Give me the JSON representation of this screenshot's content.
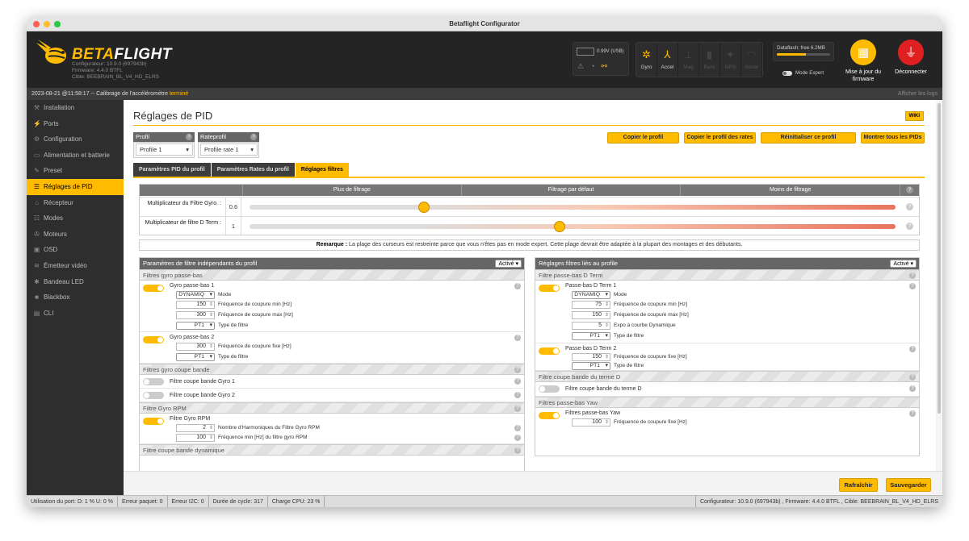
{
  "window": {
    "title": "Betaflight Configurator"
  },
  "header": {
    "brand_a": "BETA",
    "brand_b": "FLIGHT",
    "configurator": "Configurateur: 10.9.0 (697943b)",
    "firmware": "Firmware: 4.4.0 BTFL",
    "target": "Cible: BEEBRAIN_BL_V4_HD_ELRS",
    "battery": "0.99V (USB)",
    "sensors": [
      {
        "label": "Gyro",
        "icon": "gyro-icon",
        "active": true
      },
      {
        "label": "Accel",
        "icon": "accel-icon",
        "active": true
      },
      {
        "label": "Mag",
        "icon": "mag-icon",
        "active": false
      },
      {
        "label": "Baro",
        "icon": "baro-icon",
        "active": false
      },
      {
        "label": "GPS",
        "icon": "gps-icon",
        "active": false
      },
      {
        "label": "Sonar",
        "icon": "sonar-icon",
        "active": false
      }
    ],
    "dataflash": "Dataflash: free 6.2MB",
    "dataflash_fill": 0.55,
    "expert_mode": "Mode Expert",
    "update_label_1": "Mise à jour du",
    "update_label_2": "firmware",
    "disconnect_label": "Déconnecter"
  },
  "logbar": {
    "text": "2023-08-21 @11:58:17 -- Calibrage de l'accéléromètre",
    "status": "terminé",
    "show_logs": "Afficher les logs"
  },
  "sidebar": {
    "items": [
      {
        "label": "Installation",
        "icon": "wrench-icon",
        "active": false
      },
      {
        "label": "Ports",
        "icon": "plug-icon",
        "active": false
      },
      {
        "label": "Configuration",
        "icon": "gear-icon",
        "active": false
      },
      {
        "label": "Alimentation et batterie",
        "icon": "battery-icon",
        "active": false
      },
      {
        "label": "Preset",
        "icon": "preset-icon",
        "active": false
      },
      {
        "label": "Réglages de PID",
        "icon": "sliders-icon",
        "active": true
      },
      {
        "label": "Récepteur",
        "icon": "receiver-icon",
        "active": false
      },
      {
        "label": "Modes",
        "icon": "modes-icon",
        "active": false
      },
      {
        "label": "Moteurs",
        "icon": "motor-icon",
        "active": false
      },
      {
        "label": "OSD",
        "icon": "osd-icon",
        "active": false
      },
      {
        "label": "Émetteur vidéo",
        "icon": "vtx-icon",
        "active": false
      },
      {
        "label": "Bandeau LED",
        "icon": "led-icon",
        "active": false
      },
      {
        "label": "Blackbox",
        "icon": "blackbox-icon",
        "active": false
      },
      {
        "label": "CLI",
        "icon": "cli-icon",
        "active": false
      }
    ]
  },
  "main": {
    "title": "Réglages de PID",
    "wiki": "WIKI",
    "profile_label": "Profil",
    "profile_value": "Profile 1",
    "rateprofile_label": "Rateprofil",
    "rateprofile_value": "Profile rate 1",
    "buttons": {
      "copy_profile": "Copier le profil",
      "copy_rates": "Copier le profil des rates",
      "reset_profile": "Réinitialiser ce profil",
      "show_pids": "Montrer tous les PIDs"
    },
    "tabs": [
      {
        "label": "Paramètres PID du profil",
        "active": false
      },
      {
        "label": "Paramètres Rates du profil",
        "active": false
      },
      {
        "label": "Réglages filtres",
        "active": true
      }
    ],
    "slider_header": [
      "Plus de filtrage",
      "Filtrage par défaut",
      "Moins de filtrage"
    ],
    "sliders": [
      {
        "label": "Multiplicateur du Filtre Gyro. :",
        "value": "0.6",
        "fraction": 0.27
      },
      {
        "label": "Multiplicateur de filtre D Term :",
        "value": "1",
        "fraction": 0.48
      }
    ],
    "note_bold": "Remarque :",
    "note": "La plage des curseurs est restreinte parce que vous n'êtes pas en mode expert. Cette plage devrait être adaptée à la plupart des montages et des débutants.",
    "left_panel": {
      "title": "Paramètres de filtre indépendants du profil",
      "state": "Activé",
      "sec_gyro_lp": "Filtres gyro passe-bas",
      "gyro_lp1": "Gyro passe-bas 1",
      "gyro_lp1_mode": "DYNAMIQ",
      "gyro_lp1_mode_label": "Mode",
      "gyro_lp1_min": "150",
      "gyro_lp1_min_label": "Fréquence de coupure min [Hz]",
      "gyro_lp1_max": "300",
      "gyro_lp1_max_label": "Fréquence de coupure max [Hz]",
      "gyro_lp1_type": "PT1",
      "gyro_lp1_type_label": "Type de filtre",
      "gyro_lp2": "Gyro passe-bas 2",
      "gyro_lp2_freq": "300",
      "gyro_lp2_freq_label": "Fréquence de coupure fixe [Hz]",
      "gyro_lp2_type": "PT1",
      "gyro_lp2_type_label": "Type de filtre",
      "sec_notch": "Filtres gyro coupe bande",
      "notch1": "Filtre coupe bande Gyro 1",
      "notch2": "Filtre coupe bande Gyro 2",
      "sec_rpm": "Filtre Gyro RPM",
      "rpm_name": "Filtre Gyro RPM",
      "rpm_harm": "2",
      "rpm_harm_label": "Nombre d'Harmoniques du Filtre Gyro RPM",
      "rpm_min": "100",
      "rpm_min_label": "Fréquence min [Hz] du filtre gyro RPM",
      "sec_dyn": "Filtre coupe bande dynamique"
    },
    "right_panel": {
      "title": "Réglages filtres liés au profile",
      "state": "Activé",
      "sec_dterm_lp": "Filtre passe-bas D Term",
      "dlp1": "Passe-bas D Term 1",
      "dlp1_mode": "DYNAMIQ",
      "dlp1_mode_label": "Mode",
      "dlp1_min": "75",
      "dlp1_min_label": "Fréquence de coupure min [Hz]",
      "dlp1_max": "150",
      "dlp1_max_label": "Fréquence de coupure max [Hz]",
      "dlp1_expo": "5",
      "dlp1_expo_label": "Expo à courbe Dynamique",
      "dlp1_type": "PT1",
      "dlp1_type_label": "Type de filtre",
      "dlp2": "Passe-bas D Term 2",
      "dlp2_freq": "150",
      "dlp2_freq_label": "Fréquence de coupure fixe [Hz]",
      "dlp2_type": "PT1",
      "dlp2_type_label": "Type de filtre",
      "sec_dnotch": "Filtre coupe bande du terme D",
      "dnotch": "Filtre coupe bande du terme D",
      "sec_yaw": "Filtres passe-bas Yaw",
      "yaw": "Filtres passe-bas Yaw",
      "yaw_freq": "100",
      "yaw_freq_label": "Fréquence de coupure fixe [Hz]"
    },
    "refresh": "Rafraîchir",
    "save": "Sauvegarder"
  },
  "status": {
    "port": "Utilisation du port: D: 1 % U: 0 %",
    "packet": "Erreur paquet: 0",
    "i2c": "Erreur I2C: 0",
    "cycle": "Durée de cycle: 317",
    "cpu": "Charge CPU: 23 %",
    "right": "Configurateur: 10.9.0 (697943b) , Firmware: 4.4.0 BTFL , Cible: BEEBRAIN_BL_V4_HD_ELRS"
  },
  "colors": {
    "accent": "#ffbb00",
    "dark": "#242424",
    "sidebar": "#2e2e2e",
    "disconnect": "#e02020"
  }
}
